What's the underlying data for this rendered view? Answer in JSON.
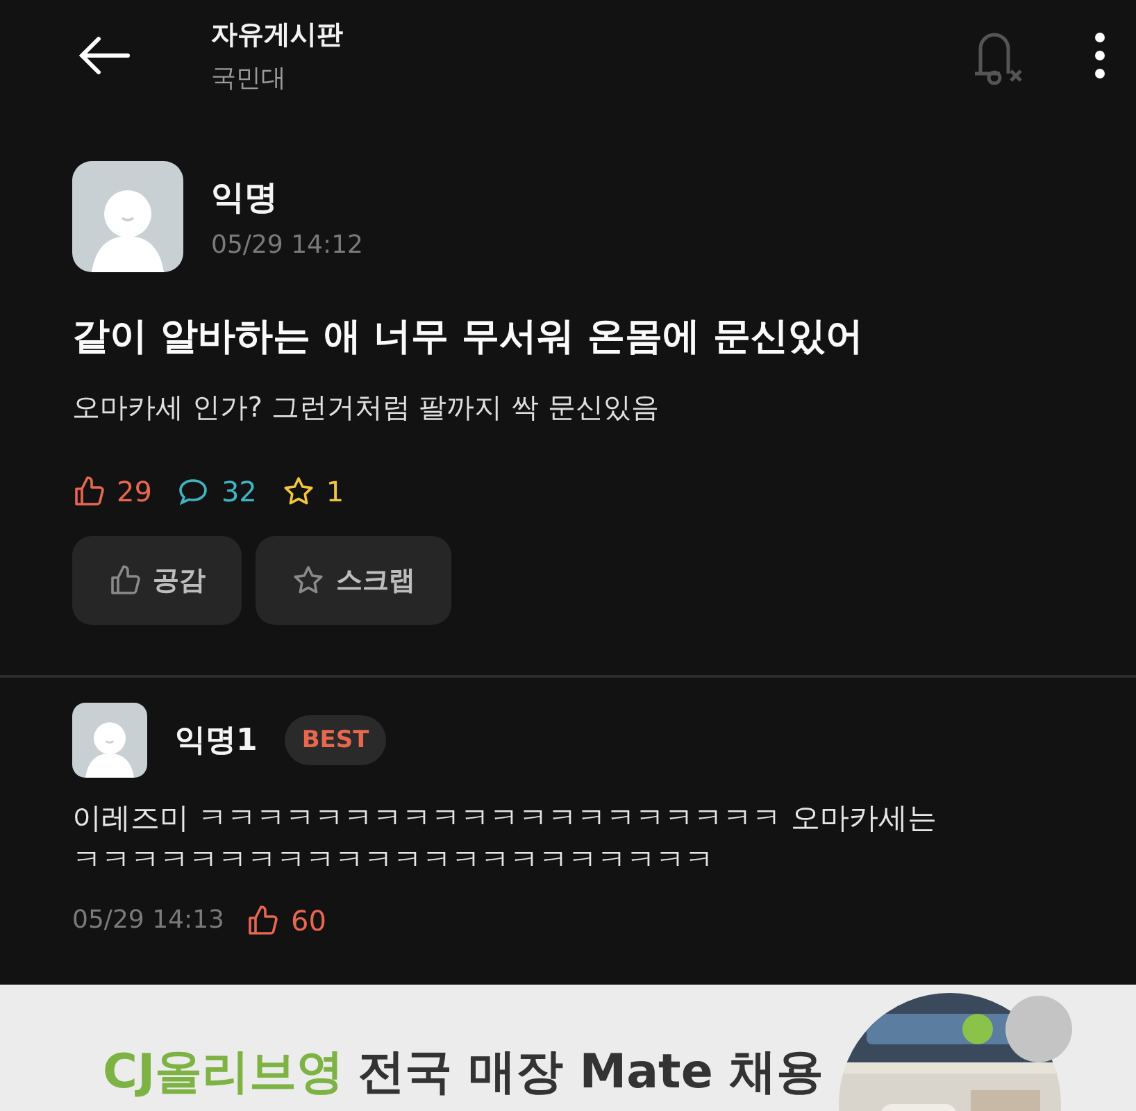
{
  "header": {
    "title": "자유게시판",
    "subtitle": "국민대",
    "notifications_off": true
  },
  "post": {
    "author": "익명",
    "time": "05/29 14:12",
    "title": "같이 알바하는 애 너무 무서워 온몸에 문신있어",
    "body": "오마카세 인가? 그런거처럼 팔까지 싹 문신있음",
    "stats": [
      {
        "kind": "like",
        "count": "29",
        "color": "#e8674f"
      },
      {
        "kind": "comment",
        "count": "32",
        "color": "#3fb5c4"
      },
      {
        "kind": "scrap",
        "count": "1",
        "color": "#f2c53d"
      }
    ],
    "buttons": [
      {
        "kind": "like",
        "label": "공감"
      },
      {
        "kind": "scrap",
        "label": "스크랩"
      }
    ]
  },
  "comments": [
    {
      "author": "익명1",
      "badge": "BEST",
      "body": "이레즈미 ㅋㅋㅋㅋㅋㅋㅋㅋㅋㅋㅋㅋㅋㅋㅋㅋㅋㅋㅋㅋ 오마카세는 ㅋㅋㅋㅋㅋㅋㅋㅋㅋㅋㅋㅋㅋㅋㅋㅋㅋㅋㅋㅋㅋㅋ",
      "time": "05/29 14:13",
      "likes": "60"
    }
  ],
  "ad": {
    "brand": "CJ올리브영",
    "headline": "전국 매장 Mate 채용"
  }
}
